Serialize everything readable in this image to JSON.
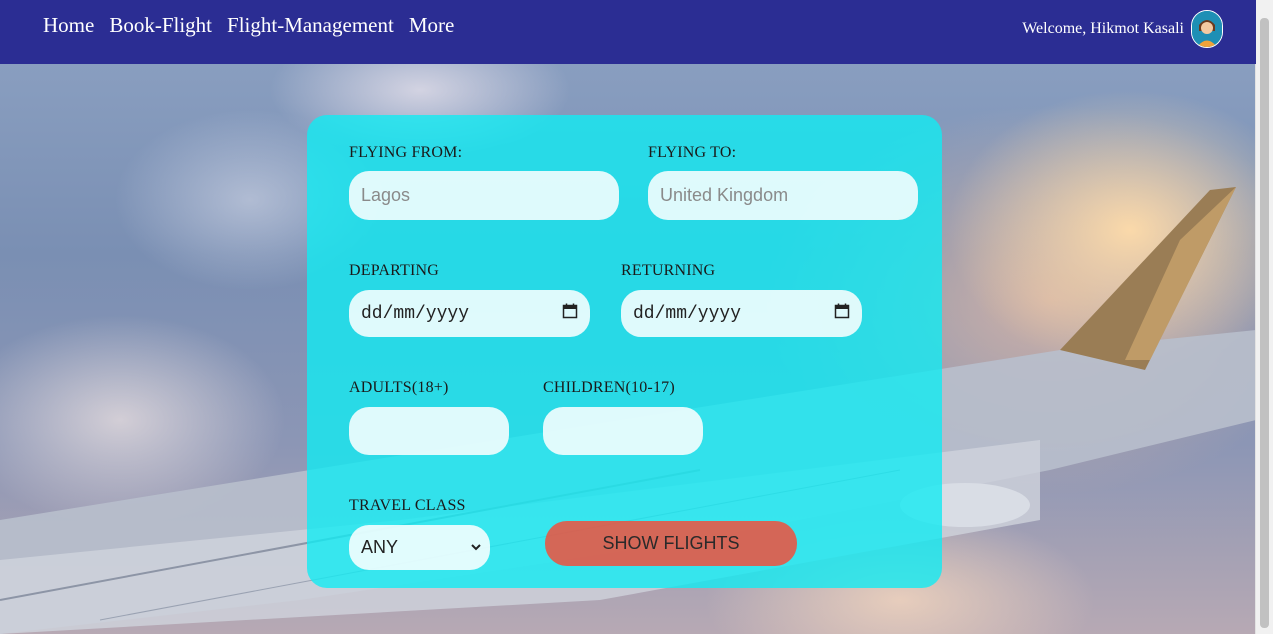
{
  "nav": {
    "links": [
      "Home",
      "Book-Flight",
      "Flight-Management",
      "More"
    ],
    "welcome": "Welcome, Hikmot Kasali"
  },
  "form": {
    "from_label": "FLYING FROM:",
    "from_placeholder": "Lagos",
    "to_label": "FLYING TO:",
    "to_placeholder": "United Kingdom",
    "departing_label": "DEPARTING",
    "departing_value": "dd/mm/yyyy",
    "returning_label": "RETURNING",
    "returning_value": "dd/mm/yyyy",
    "adults_label": "ADULTS(18+)",
    "children_label": "CHILDREN(10-17)",
    "class_label": "TRAVEL CLASS",
    "class_selected": "ANY",
    "submit_label": "SHOW FLIGHTS"
  },
  "colors": {
    "navbar": "#2b2d93",
    "card": "#12ebf2",
    "button": "#f0503c"
  }
}
